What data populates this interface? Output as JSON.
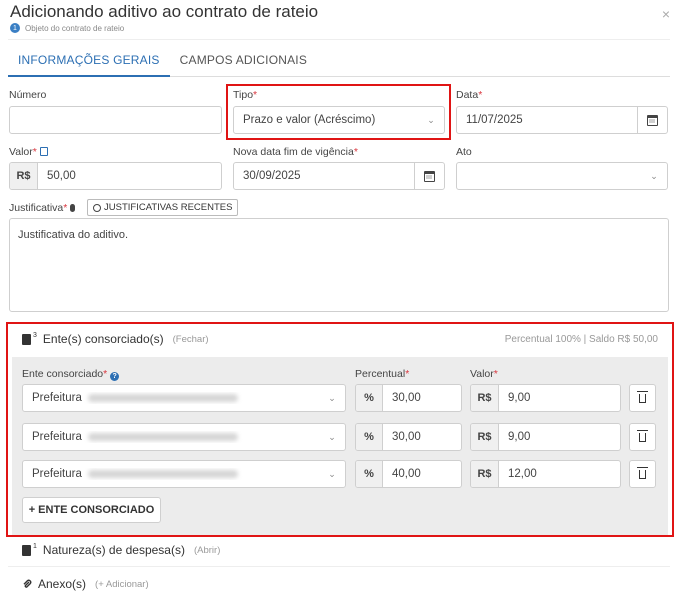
{
  "header": {
    "title": "Adicionando aditivo ao contrato de rateio",
    "step_number": "1",
    "step_label": "Objeto do contrato de rateio",
    "close_label": "×"
  },
  "tabs": [
    "INFORMAÇÕES GERAIS",
    "CAMPOS ADICIONAIS"
  ],
  "form": {
    "numero": {
      "label": "Número",
      "value": ""
    },
    "tipo": {
      "label": "Tipo",
      "required": "*",
      "value": "Prazo e valor (Acréscimo)"
    },
    "data": {
      "label": "Data",
      "required": "*",
      "value": "11/07/2025"
    },
    "valor": {
      "label": "Valor",
      "required": "*",
      "prefix": "R$",
      "value": "50,00"
    },
    "nova_data": {
      "label": "Nova data fim de vigência",
      "required": "*",
      "value": "30/09/2025"
    },
    "ato": {
      "label": "Ato",
      "value": ""
    },
    "justificativa": {
      "label": "Justificativa",
      "required": "*",
      "recent_button": "JUSTIFICATIVAS RECENTES",
      "value": "Justificativa do aditivo."
    }
  },
  "entes": {
    "title": "Ente(s) consorciado(s)",
    "count": "3",
    "toggle": "(Fechar)",
    "summary": "Percentual 100% | Saldo R$ 50,00",
    "col_ente": "Ente consorciado",
    "col_percentual": "Percentual",
    "col_valor": "Valor",
    "required": "*",
    "pct_prefix": "%",
    "val_prefix": "R$",
    "rows": [
      {
        "ente": "Prefeitura",
        "percentual": "30,00",
        "valor": "9,00"
      },
      {
        "ente": "Prefeitura",
        "percentual": "30,00",
        "valor": "9,00"
      },
      {
        "ente": "Prefeitura",
        "percentual": "40,00",
        "valor": "12,00"
      }
    ],
    "add_button": "+ ENTE CONSORCIADO"
  },
  "natureza": {
    "title": "Natureza(s) de despesa(s)",
    "count": "1",
    "toggle": "(Abrir)"
  },
  "anexos": {
    "title": "Anexo(s)",
    "toggle": "(+ Adicionar)"
  },
  "colors": {
    "accent": "#2c6fb3",
    "highlight": "#e01414",
    "required": "#d9363e"
  }
}
